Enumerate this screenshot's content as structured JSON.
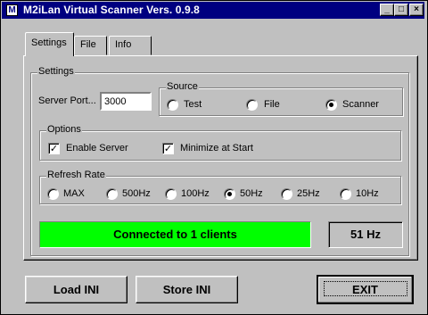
{
  "window": {
    "title": "M2iLan Virtual Scanner  Vers. 0.9.8"
  },
  "title_controls": {
    "minimize": "_",
    "maximize": "□",
    "close": "×"
  },
  "tabs": [
    {
      "label": "Settings"
    },
    {
      "label": "File"
    },
    {
      "label": "Info"
    }
  ],
  "settings": {
    "group_label": "Settings",
    "server_port_label": "Server Port...",
    "server_port_value": "3000",
    "source": {
      "label": "Source",
      "options": [
        {
          "label": "Test"
        },
        {
          "label": "File"
        },
        {
          "label": "Scanner"
        }
      ],
      "selected": "Scanner"
    },
    "options": {
      "label": "Options",
      "enable_server": {
        "label": "Enable Server",
        "checked": true
      },
      "minimize_at_start": {
        "label": "Minimize at Start",
        "checked": true
      }
    },
    "refresh_rate": {
      "label": "Refresh Rate",
      "options": [
        {
          "label": "MAX"
        },
        {
          "label": "500Hz"
        },
        {
          "label": "100Hz"
        },
        {
          "label": "50Hz"
        },
        {
          "label": "25Hz"
        },
        {
          "label": "10Hz"
        }
      ],
      "selected": "50Hz"
    }
  },
  "status": {
    "text": "Connected to 1 clients",
    "color": "#00ff00",
    "rate": "51 Hz"
  },
  "buttons": {
    "load": "Load INI",
    "store": "Store INI",
    "exit": "EXIT"
  },
  "colors": {
    "titlebar": "#000080",
    "face": "#c0c0c0"
  }
}
